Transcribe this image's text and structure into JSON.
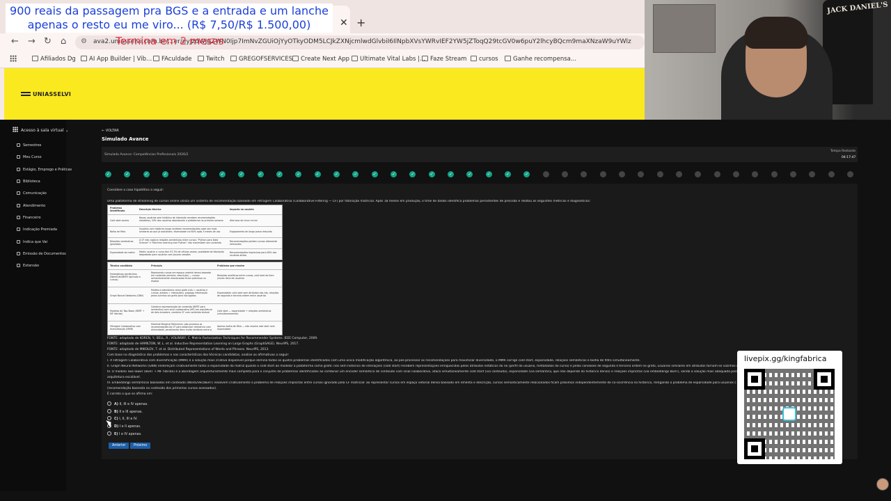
{
  "overlay": {
    "title": "900 reais da passagem pra BGS e a entrada e um lanche apenas o resto eu me viro... (R$ 7,50/R$ 1.500,00)",
    "red_text": "Termina em 2 meses"
  },
  "browser": {
    "url": "ava2.uniasselvi.com.br/...er/eyJzdWJqZWN0Ijp7ImNvZGUiOjYyOTkyODM5LCJkZXNjcmlwdGlvbiI6IlNpbXVsYWRvIEF2YW5jZToqQ29tcGV0w6puY2lhcyBQcm9maXNzaW9uYWlz",
    "bookmarks": [
      "Afiliados Dg",
      "AI App Builder | Vib...",
      "FAculdade",
      "Twitch",
      "GREGOFSERVICES",
      "Create Next App",
      "Ultimate Vital Labs |...",
      "Faze Stream",
      "cursos",
      "Ganhe recompensa..."
    ]
  },
  "banner": {
    "logo": "UNIASSELVI"
  },
  "webcam": {
    "brand": "JACK DANIEL'S"
  },
  "sidebar": {
    "header": "Acesso à sala virtual",
    "items": [
      "Semestres",
      "Meu Curso",
      "Estágio, Emprego e Práticas",
      "Biblioteca",
      "Comunicação",
      "Atendimento",
      "Financeiro",
      "Indicação Premiada",
      "Indica que Vai",
      "Emissão de Documentos",
      "Extensão"
    ]
  },
  "exam": {
    "back": "← VOLTAR",
    "title": "Simulado Avance",
    "subtitle": "Simulado Avance: Competências Profissionais 2026/2",
    "timer_label": "Tempo Restante",
    "timer": "04:17:47",
    "progress": {
      "answered": 23,
      "total": 40
    },
    "intro": "Considere o caso hipotético a seguir:",
    "context": "Uma plataforma de streaming de cursos online utiliza um sistema de recomendação baseado em Filtragem Colaborativa (Collaborative Filtering — CF) por fatoração matricial. Após 18 meses em produção, o time de dados identifica problemas persistentes de precisão e relatou as seguintes métricas e diagnósticos:",
    "table1": {
      "headers": [
        "Problema Identificado",
        "Descrição técnica",
        "Impacto no usuário"
      ],
      "rows": [
        [
          "Cold start severo",
          "Novos usuários sem histórico de interação recebem recomendações aleatórias; 34% dos usuários abandonam a plataforma na primeira semana",
          "Alta taxa de churn inicial"
        ],
        [
          "Bolha de filtro",
          "Usuários com histórico longo recebem recomendações cada vez mais similares ao que já assistiram; diversidade cai 60% após 3 meses de uso",
          "Engajamento de longo prazo reduzido"
        ],
        [
          "Relações semânticas ignoradas",
          "A CF não captura relações semânticas entre cursos: \"Python para Data Science\" e \"Machine Learning com Python\" não maximizam seu conteúdo",
          "Recomendações perdem cursos altamente relevantes"
        ],
        [
          "Esparsidade da matriz",
          "Matriz usuário × curso tem 97,3% de células vazias; qualidade da fatoração degradada para usuários com poucas sessões",
          "Recomendações imprecisas para 58% dos usuários ativos"
        ]
      ]
    },
    "table2": {
      "headers": [
        "Técnica candidata",
        "Princípio",
        "Problema que resolve"
      ],
      "rows": [
        [
          "Embeddings semânticos (Word2Vec/BERT aplicado a cursos)",
          "Representa cursos em espaço vetorial denso baseado em conteúdo (ementa, descrição) — cursos semanticamente relacionados ficam próximos no espaço",
          "Relações analíticas entre cursos; cold start do item (novos itens de usuários"
        ],
        [
          "Graph Neural Networks (GNN)",
          "Modela a plataforma como grafo (nós = usuários e cursos; arestas = interações), propaga informação pelos vizinhos via grafo para nós ligados",
          "Esparsidade; cold start sem atributos dos nós, relações de segunda e terceira ordem entre usuários"
        ],
        [
          "Modelos de Two-Tower (BERT + MF híbrido)",
          "Combina representação de conteúdo (BERT para semântica) com sinal colaborativo (MF) em arquitetura de dois encoders; combina CF com conteúdo textual",
          "Cold start — esparsidade + relações semânticas (simultaneamente)"
        ],
        [
          "Filtragem Colaborativa com diversificação (MMR)",
          "Maximal Marginal Relevance: pós-processa as recomendações da CF para balancear relevância com diversidade, penalizando itens muito similares entre si",
          "Apenas bolha de filtro — não resolve cold start nem esparsidade"
        ]
      ]
    },
    "sources": [
      "FONTE: adaptado de KOREN, Y.; BELL, R.; VOLINSKY, C. Matrix Factorization Techniques for Recommender Systems. IEEE Computer, 2009.",
      "FONTE: adaptado de HAMILTON, W. L. et al. Inductive Representation Learning on Large Graphs (GraphSAGE). NeurIPS, 2017.",
      "FONTE: adaptado de MIKOLOV, T. et al. Distributed Representations of Words and Phrases. NeurIPS, 2013."
    ],
    "statements": [
      "Com base no diagnóstico dos problemas e nas características das técnicas candidatas, analise as afirmativas a seguir:",
      "I. A Filtragem Colaborativa com diversificação (MMR) é a solução mais criativa disponível porque elimina todos os quatro problemas identificados com uma única modificação algorítmica, ao pós-processar as recomendações para maximizar diversidade, o MMR corrige cold start, esparsidade, relações semânticas e bolha de filtro simultaneamente.",
      "II. Graph Neural Networks (GNN) endereçam criativamente tanto a esparsidade da matriz quanto o cold start ao modelar a plataforma como grafo: nós sem histórico de interações (cold start) recebem representações enriquecidas pelos atributos estáticos do nó (perfil do usuário, metadados do curso) e pelas conexões de segunda e terceira ordem no grafo, usuários similares em atributos tornam-se vizinhos de p",
      "III. O modelo Two-Tower (BERT + MF híbrido) é a abordagem arquiteturalmente mais completa para o conjunto de problemas identificados ao combinar um encoder semântico de conteúdo com sinal colaborativo, ataca simultaneamente cold start (via conteúdo), esparsidade (via semântica, que não depende do histórico denso) e relações implícitas (via embeddings BERT), sendo a solução mais adequada para p",
      "arquitetura escalável.",
      "IV. Embeddings semânticos baseados em conteúdo (Word2Vec/BERT) resolvem criativamente o problema de relações implícitas entre cursos ignorado pela CF matricial: ao representar cursos em espaço vetorial denso baseado em ementa e descrição, cursos semanticamente relacionados ficam próximos independentemente de co-ocorrência no histórico, mitigando o problema de esparsidade para usuários c",
      "(recomendação baseada no conteúdo dos primeiros cursos acessados).",
      "É correto o que se afirma em:"
    ],
    "options": [
      {
        "letter": "A)",
        "text": "II, III e IV apenas."
      },
      {
        "letter": "B)",
        "text": "II e III apenas."
      },
      {
        "letter": "C)",
        "text": "I, II, III e IV."
      },
      {
        "letter": "D)",
        "text": "I e II apenas."
      },
      {
        "letter": "E)",
        "text": "I e IV apenas."
      }
    ],
    "buttons": {
      "prev": "Anterior",
      "next": "Próximo"
    }
  },
  "qr": {
    "label": "livepix.gg/kingfabrica"
  },
  "colors": {
    "banner": "#fbe91f",
    "progress_done": "#13a386",
    "button": "#1d5fa8",
    "overlay_title": "#1a3fd8",
    "overlay_red": "#e8233a"
  }
}
